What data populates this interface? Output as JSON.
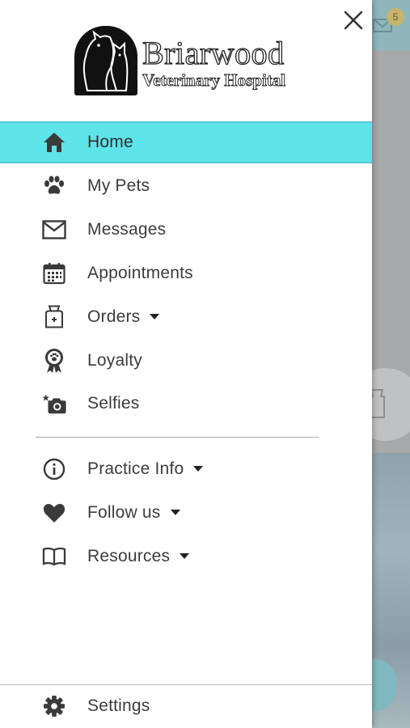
{
  "background": {
    "notification_badge": "5"
  },
  "drawer": {
    "logo": {
      "name": "Briarwood",
      "subtitle": "Veterinary Hospital"
    },
    "menu": [
      {
        "label": "Home",
        "icon": "home-icon",
        "active": true
      },
      {
        "label": "My Pets",
        "icon": "paw-icon"
      },
      {
        "label": "Messages",
        "icon": "mail-icon"
      },
      {
        "label": "Appointments",
        "icon": "calendar-icon"
      },
      {
        "label": "Orders",
        "icon": "pet-food-bag-icon",
        "has_dropdown": true
      },
      {
        "label": "Loyalty",
        "icon": "ribbon-award-icon"
      },
      {
        "label": "Selfies",
        "icon": "camera-icon"
      }
    ],
    "secondary_menu": [
      {
        "label": "Practice Info",
        "icon": "info-icon",
        "has_dropdown": true
      },
      {
        "label": "Follow us",
        "icon": "heart-icon",
        "has_dropdown": true
      },
      {
        "label": "Resources",
        "icon": "book-icon",
        "has_dropdown": true
      }
    ],
    "footer": {
      "label": "Settings",
      "icon": "gear-icon"
    }
  },
  "colors": {
    "active_background": "#5de3e8",
    "icon_color": "#3c3c3c",
    "text_color": "#3c3c3c"
  }
}
